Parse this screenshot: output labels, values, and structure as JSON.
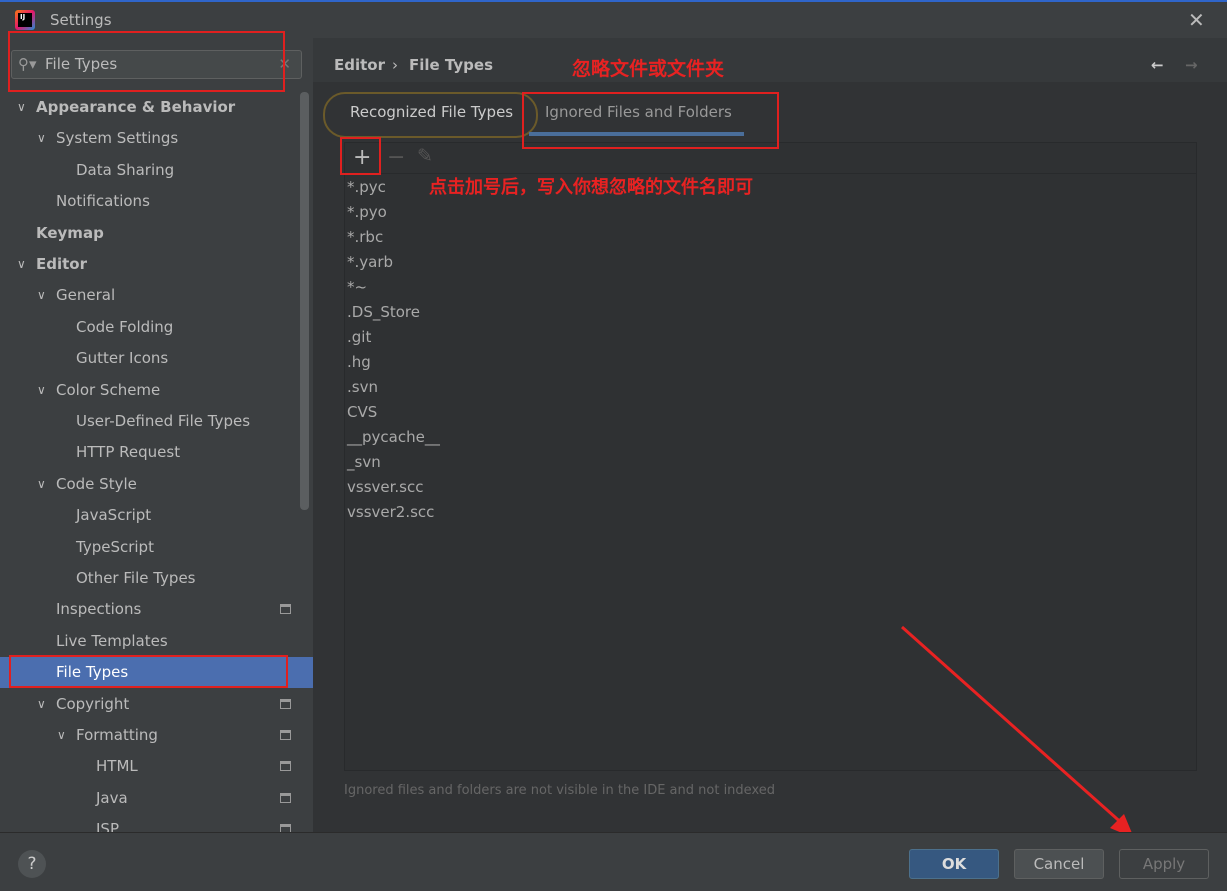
{
  "window": {
    "title": "Settings",
    "close": "✕"
  },
  "search": {
    "value": "File Types",
    "icon": "search-icon",
    "clear": "✕"
  },
  "sidebar": {
    "items": [
      {
        "label": "Appearance & Behavior",
        "level": 0,
        "expanded": true,
        "bold": true
      },
      {
        "label": "System Settings",
        "level": 1,
        "expanded": true
      },
      {
        "label": "Data Sharing",
        "level": 2
      },
      {
        "label": "Notifications",
        "level": 1
      },
      {
        "label": "Keymap",
        "level": 0,
        "bold": true
      },
      {
        "label": "Editor",
        "level": 0,
        "expanded": true,
        "bold": true
      },
      {
        "label": "General",
        "level": 1,
        "expanded": true
      },
      {
        "label": "Code Folding",
        "level": 2
      },
      {
        "label": "Gutter Icons",
        "level": 2
      },
      {
        "label": "Color Scheme",
        "level": 1,
        "expanded": true
      },
      {
        "label": "User-Defined File Types",
        "level": 2
      },
      {
        "label": "HTTP Request",
        "level": 2
      },
      {
        "label": "Code Style",
        "level": 1,
        "expanded": true
      },
      {
        "label": "JavaScript",
        "level": 2
      },
      {
        "label": "TypeScript",
        "level": 2
      },
      {
        "label": "Other File Types",
        "level": 2
      },
      {
        "label": "Inspections",
        "level": 1,
        "page_icon": true
      },
      {
        "label": "Live Templates",
        "level": 1
      },
      {
        "label": "File Types",
        "level": 1,
        "selected": true
      },
      {
        "label": "Copyright",
        "level": 1,
        "expanded": true,
        "page_icon": true
      },
      {
        "label": "Formatting",
        "level": 2,
        "expanded": true,
        "page_icon": true
      },
      {
        "label": "HTML",
        "level": 3,
        "page_icon": true
      },
      {
        "label": "Java",
        "level": 3,
        "page_icon": true
      },
      {
        "label": "JSP",
        "level": 3,
        "page_icon": true
      }
    ]
  },
  "breadcrumb": {
    "parent": "Editor",
    "sep": "›",
    "current": "File Types",
    "back": "←",
    "forward": "→"
  },
  "tabs": [
    {
      "label": "Recognized File Types",
      "active": false
    },
    {
      "label": "Ignored Files and Folders",
      "active": true
    }
  ],
  "toolbar": {
    "add": "+",
    "remove": "−",
    "edit": "✎"
  },
  "ignored": [
    "*.pyc",
    "*.pyo",
    "*.rbc",
    "*.yarb",
    "*~",
    ".DS_Store",
    ".git",
    ".hg",
    ".svn",
    "CVS",
    "__pycache__",
    "_svn",
    "vssver.scc",
    "vssver2.scc"
  ],
  "hint": "Ignored files and folders are not visible in the IDE and not indexed",
  "annotations": {
    "title": "忽略文件或文件夹",
    "instruction": "点击加号后，写入你想忽略的文件名即可"
  },
  "footer": {
    "help": "?",
    "ok": "OK",
    "cancel": "Cancel",
    "apply": "Apply"
  },
  "colors": {
    "accent": "#4b6eaf",
    "annotation": "#e82222",
    "ok_button": "#365880"
  }
}
